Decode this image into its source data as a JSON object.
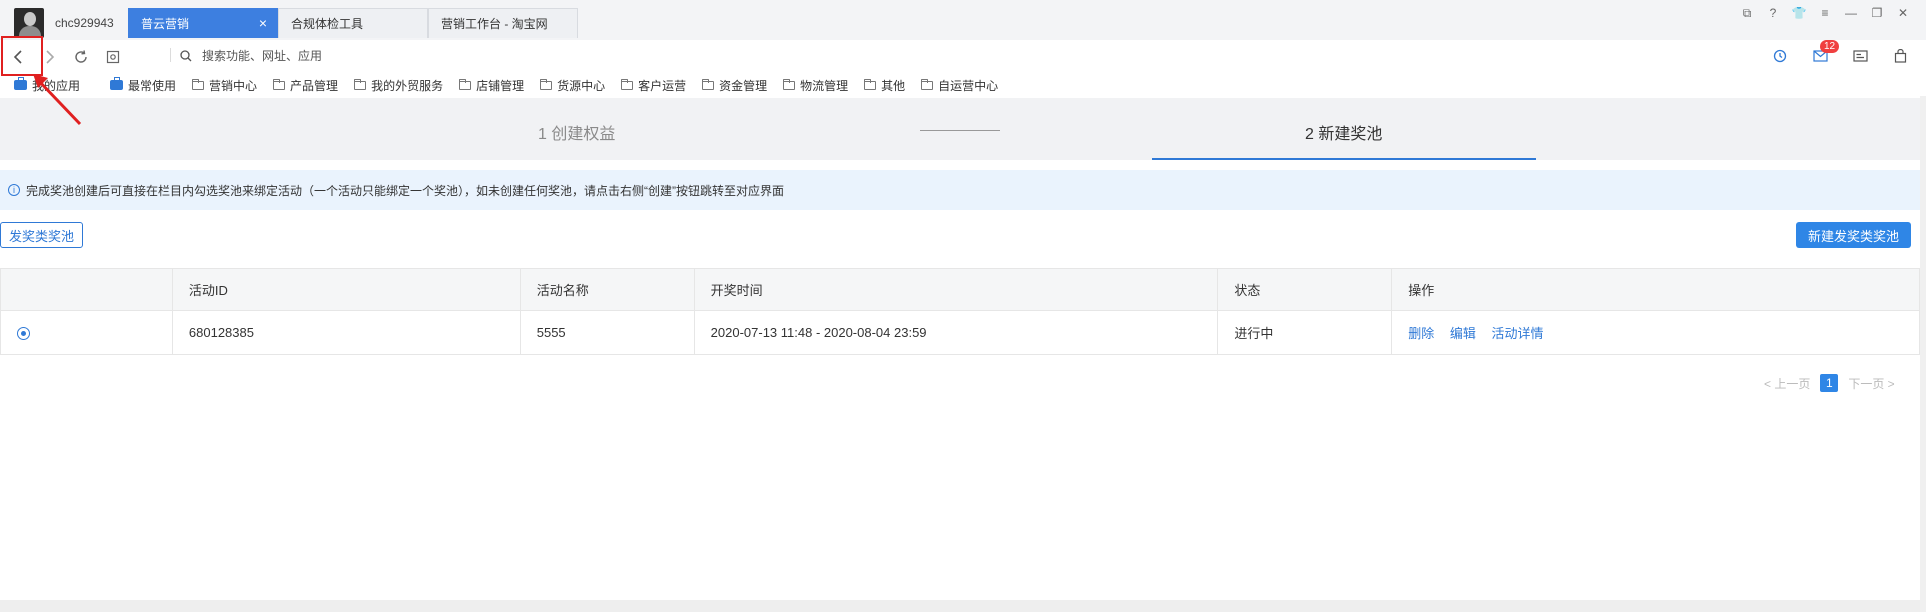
{
  "titlebar": {
    "username": "chc929943",
    "tabs": [
      {
        "label": "普云营销",
        "active": true,
        "close": "×"
      },
      {
        "label": "合规体检工具",
        "active": false
      },
      {
        "label": "营销工作台 - 淘宝网",
        "active": false
      }
    ]
  },
  "navbar": {
    "search_placeholder": "搜索功能、网址、应用",
    "mail_badge": "12"
  },
  "bookmarks": [
    {
      "label": "我的应用",
      "icon": "briefcase-icon"
    },
    {
      "label": "最常使用",
      "icon": "briefcase-icon"
    },
    {
      "label": "营销中心",
      "icon": "folder-icon"
    },
    {
      "label": "产品管理",
      "icon": "folder-icon"
    },
    {
      "label": "我的外贸服务",
      "icon": "folder-icon"
    },
    {
      "label": "店铺管理",
      "icon": "folder-icon"
    },
    {
      "label": "货源中心",
      "icon": "folder-icon"
    },
    {
      "label": "客户运营",
      "icon": "folder-icon"
    },
    {
      "label": "资金管理",
      "icon": "folder-icon"
    },
    {
      "label": "物流管理",
      "icon": "folder-icon"
    },
    {
      "label": "其他",
      "icon": "folder-icon"
    },
    {
      "label": "自运营中心",
      "icon": "folder-icon"
    }
  ],
  "steps": {
    "step1": "1 创建权益",
    "step2": "2 新建奖池"
  },
  "info": {
    "text": "完成奖池创建后可直接在栏目内勾选奖池来绑定活动（一个活动只能绑定一个奖池），如未创建任何奖池，请点击右侧“创建”按钮跳转至对应界面"
  },
  "actions": {
    "filter_label": "发奖类奖池",
    "create_label": "新建发奖类奖池"
  },
  "table": {
    "headers": [
      "",
      "活动ID",
      "活动名称",
      "开奖时间",
      "状态",
      "操作"
    ],
    "rows": [
      {
        "id": "680128385",
        "name": "5555",
        "time": "2020-07-13 11:48 - 2020-08-04 23:59",
        "status": "进行中",
        "ops": [
          "删除",
          "编辑",
          "活动详情"
        ]
      }
    ]
  },
  "pager": {
    "prev": "< 上一页",
    "current": "1",
    "next": "下一页 >"
  },
  "colors": {
    "accent": "#2f79d6",
    "highlight_red": "#e02020"
  }
}
